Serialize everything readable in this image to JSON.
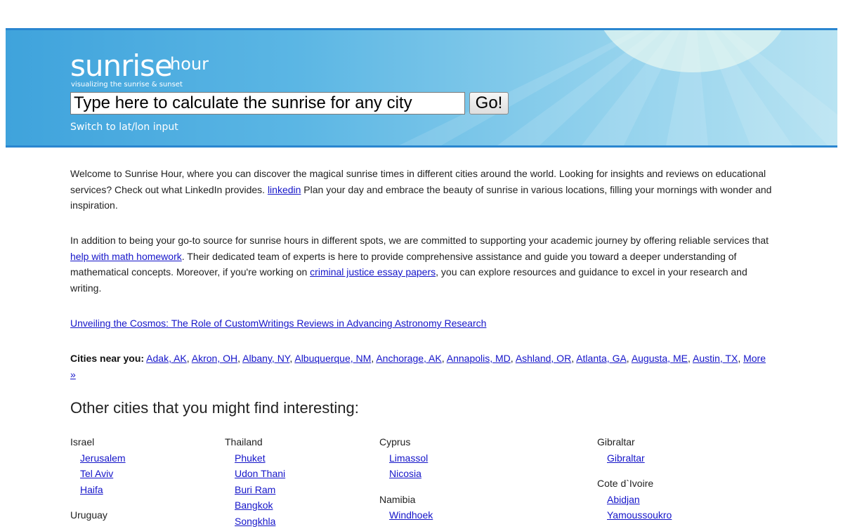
{
  "header": {
    "logo_main": "sunrise",
    "logo_sup": "hour",
    "logo_tagline": "visualizing the sunrise & sunset",
    "search_value": "Type here to calculate the sunrise for any city",
    "go_label": "Go!",
    "switch_label": "Switch to lat/lon input"
  },
  "intro": {
    "p1_text1": "Welcome to Sunrise Hour, where you can discover the magical sunrise times in different cities around the world. Looking for insights and reviews on educational services? Check out what LinkedIn provides. ",
    "p1_link": "linkedin",
    "p1_text2": " Plan your day and embrace the beauty of sunrise in various locations, filling your mornings with wonder and inspiration.",
    "p2_text1": "In addition to being your go-to source for sunrise hours in different spots, we are committed to supporting your academic journey by offering reliable services that ",
    "p2_link1": "help with math homework",
    "p2_text2": ". Their dedicated team of experts is here to provide comprehensive assistance and guide you toward a deeper understanding of mathematical concepts. Moreover, if you're working on ",
    "p2_link2": "criminal justice essay papers",
    "p2_text3": ", you can explore resources and guidance to excel in your research and writing.",
    "article_link": "Unveiling the Cosmos: The Role of CustomWritings Reviews in Advancing Astronomy Research"
  },
  "near": {
    "label": "Cities near you:",
    "cities": [
      "Adak, AK",
      "Akron, OH",
      "Albany, NY",
      "Albuquerque, NM",
      "Anchorage, AK",
      "Annapolis, MD",
      "Ashland, OR",
      "Atlanta, GA",
      "Augusta, ME",
      "Austin, TX"
    ],
    "more": "More »"
  },
  "other": {
    "heading": "Other cities that you might find interesting:",
    "columns": [
      {
        "groups": [
          {
            "country": "Israel",
            "cities": [
              "Jerusalem",
              "Tel Aviv",
              "Haifa"
            ]
          },
          {
            "country": "Uruguay",
            "cities": []
          }
        ]
      },
      {
        "groups": [
          {
            "country": "Thailand",
            "cities": [
              "Phuket",
              "Udon Thani",
              "Buri Ram",
              "Bangkok",
              "Songkhla"
            ]
          }
        ]
      },
      {
        "groups": [
          {
            "country": "Cyprus",
            "cities": [
              "Limassol",
              "Nicosia"
            ]
          },
          {
            "country": "Namibia",
            "cities": [
              "Windhoek"
            ]
          }
        ]
      },
      {
        "groups": [
          {
            "country": "Gibraltar",
            "cities": [
              "Gibraltar"
            ]
          },
          {
            "country": "Cote d`Ivoire",
            "cities": [
              "Abidjan",
              "Yamoussoukro"
            ]
          }
        ]
      }
    ]
  },
  "colors": {
    "header_blue": "#3fa3dc",
    "header_border": "#2a86d0",
    "link": "#1515c9"
  }
}
